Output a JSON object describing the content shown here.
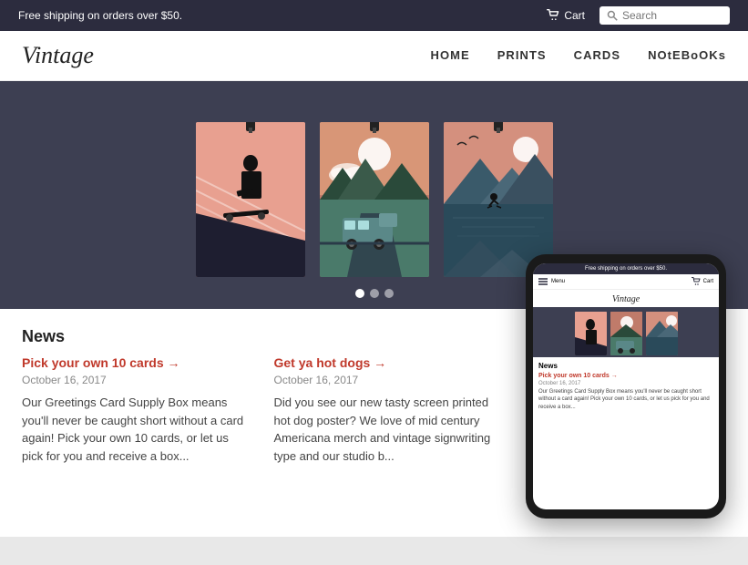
{
  "topbar": {
    "announcement": "Free shipping on orders over $50.",
    "cart_label": "Cart",
    "search_placeholder": "Search"
  },
  "nav": {
    "logo": "Vintage",
    "links": [
      {
        "label": "HOME",
        "id": "home"
      },
      {
        "label": "PRINTS",
        "id": "prints"
      },
      {
        "label": "CARDS",
        "id": "cards"
      },
      {
        "label": "NOtEBoOKs",
        "id": "notebooks"
      }
    ]
  },
  "slider": {
    "dots": [
      {
        "active": true
      },
      {
        "active": false
      },
      {
        "active": false
      }
    ]
  },
  "news": {
    "heading": "News",
    "articles": [
      {
        "link": "Pick your own 10 cards →",
        "date": "October 16, 2017",
        "text": "Our Greetings Card Supply Box means you'll never be caught short without a card again! Pick your own 10 cards, or let us pick for you and receive a box..."
      },
      {
        "link": "Get ya hot dogs →",
        "date": "October 16, 2017",
        "text": "Did you see our new tasty screen printed hot dog poster? We love of mid century Americana merch and vintage signwriting type and our studio b..."
      }
    ]
  },
  "phone": {
    "topbar": "Free shipping on orders over $50.",
    "menu_label": "Menu",
    "cart_label": "Cart",
    "logo": "Vintage",
    "news_heading": "News",
    "news_link": "Pick your own 10 cards →",
    "news_date": "October 16, 2017",
    "news_text": "Our Greetings Card Supply Box means you'll never be caught short without a card again! Pick your own 10 cards, or let us pick for you and receive a box..."
  }
}
